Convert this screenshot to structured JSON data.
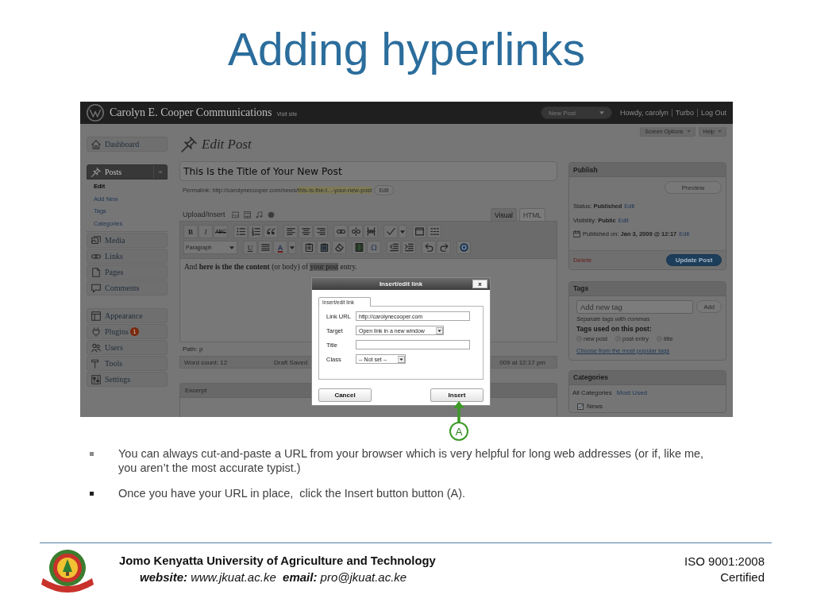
{
  "title": "Adding hyperlinks",
  "screenshot": {
    "admin_bar": {
      "site_title": "Carolyn E. Cooper Communications",
      "visit_site": "Visit site",
      "new_post": "New Post",
      "user_links": [
        "Howdy, carolyn",
        "Turbo",
        "Log Out"
      ]
    },
    "screen_tabs": [
      "Screen Options",
      "Help"
    ],
    "menu": [
      [
        {
          "label": "Dashboard",
          "selected": false
        }
      ],
      [
        {
          "label": "Posts",
          "selected": true,
          "children": [
            {
              "label": "Edit",
              "selected": true
            },
            {
              "label": "Add New",
              "selected": false
            },
            {
              "label": "Tags",
              "selected": false
            },
            {
              "label": "Categories",
              "selected": false
            }
          ]
        },
        {
          "label": "Media",
          "selected": false
        },
        {
          "label": "Links",
          "selected": false
        },
        {
          "label": "Pages",
          "selected": false
        },
        {
          "label": "Comments",
          "selected": false
        }
      ],
      [
        {
          "label": "Appearance",
          "selected": false
        },
        {
          "label": "Plugins",
          "selected": false,
          "badge": "1"
        },
        {
          "label": "Users",
          "selected": false
        },
        {
          "label": "Tools",
          "selected": false
        },
        {
          "label": "Settings",
          "selected": false
        }
      ]
    ],
    "heading": "Edit Post",
    "post_title": "This Is the Title of Your New Post",
    "permalink": {
      "label": "Permalink:",
      "url": "http://carolynecooper.com/news/",
      "slug": "this-is-the-t...-your-new-post",
      "edit": "Edit"
    },
    "editor": {
      "upload_label": "Upload/Insert",
      "tabs": [
        {
          "label": "Visual",
          "selected": true
        },
        {
          "label": "HTML",
          "selected": false
        }
      ],
      "toolbar_labels": [
        "B",
        "I",
        "ABC",
        "Paragraph",
        "U",
        "A",
        "Ω"
      ],
      "content": {
        "before": "And **here is the the content** (or body) of ",
        "selection": "your post",
        "after": " entry."
      },
      "path": "Path: p",
      "word_count": "Word count: 12",
      "draft_saved": "Draft Saved",
      "draft_time": "009 at 12:17 pm"
    },
    "excerpt": "Excerpt",
    "publish": {
      "heading": "Publish",
      "preview": "Preview",
      "lines": [
        {
          "kind": "plain",
          "text": "Status: **Published**",
          "edit": "Edit"
        },
        {
          "kind": "plain",
          "text": "Visibility: **Public**",
          "edit": "Edit"
        },
        {
          "kind": "date",
          "text": "Published on: **Jan 3, 2009 @ 12:17**",
          "edit": "Edit"
        }
      ],
      "delete": "Delete",
      "update": "Update Post"
    },
    "tags": {
      "heading": "Tags",
      "placeholder": "Add new tag",
      "add": "Add",
      "hint": "Separate tags with commas",
      "used_heading": "Tags used on this post:",
      "used": [
        "new post",
        "post entry",
        "title"
      ],
      "popular": "Choose from the most popular tags"
    },
    "categories": {
      "heading": "Categories",
      "tabs": [
        {
          "label": "All Categories",
          "selected": true
        },
        {
          "label": "Most Used",
          "selected": false
        }
      ],
      "items": [
        {
          "label": "News",
          "checked": true
        }
      ]
    },
    "dialog": {
      "title": "Insert/edit link",
      "close": "x",
      "tab": "Insert/edit link",
      "fields": [
        {
          "label": "Link URL",
          "kind": "text",
          "value": "http://carolynecooper.com"
        },
        {
          "label": "Target",
          "kind": "select",
          "value": "Open link in a new window"
        },
        {
          "label": "Title",
          "kind": "text"
        },
        {
          "label": "Class",
          "kind": "select",
          "value": "-- Not set --"
        }
      ],
      "buttons": [
        "Cancel",
        "Insert"
      ]
    }
  },
  "callout": "A",
  "bullets": [
    "You can always cut-and-paste a URL from your browser which is very helpful for long web addresses (or if, like me, you aren’t the most accurate typist.)",
    "Once you have your URL in place,  click the Insert button button (A)."
  ],
  "footer": {
    "institution": "Jomo Kenyatta University of Agriculture and Technology",
    "contact": "**website:** www.jkuat.ac.ke  **email:** pro@jkuat.ac.ke",
    "certification": [
      "ISO 9001:2008",
      "Certified"
    ]
  }
}
